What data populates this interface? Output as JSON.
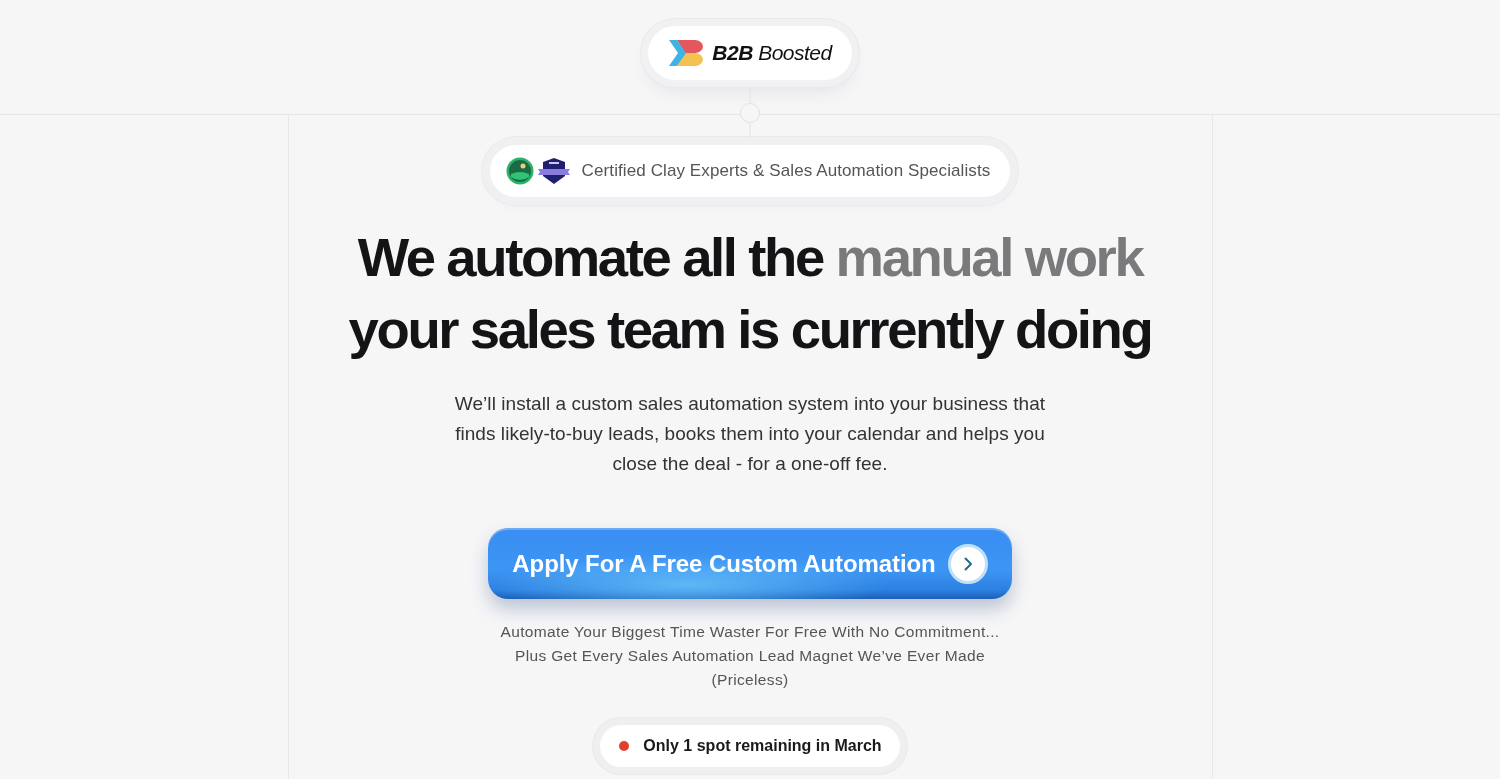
{
  "logo": {
    "text": "**B2B** Boosted"
  },
  "certification_badge": {
    "text": "Certified Clay Experts & Sales Automation Specialists"
  },
  "headline": {
    "lines": [
      [
        {
          "text": "We automate all the ",
          "muted": false
        },
        {
          "text": "manual work",
          "muted": true
        }
      ],
      [
        {
          "text": "your sales team is currently doing",
          "muted": false
        }
      ]
    ]
  },
  "description": "We’ll install a custom sales automation system into your business that finds likely-to-buy leads, books them into your calendar and helps you close the deal - for a one-off fee.",
  "cta_button": {
    "label": "Apply For A Free Custom Automation"
  },
  "offer_note": "Automate Your Biggest Time Waster For Free With No Commitment... Plus Get Every Sales Automation Lead Magnet We’ve Ever Made (Priceless)",
  "availability": {
    "text": "Only 1 spot remaining in March"
  }
}
